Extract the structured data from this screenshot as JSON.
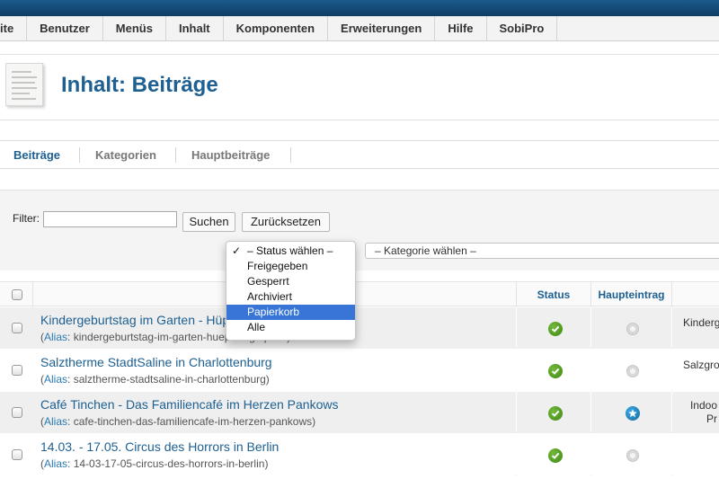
{
  "menu": {
    "items": [
      "ite",
      "Benutzer",
      "Menüs",
      "Inhalt",
      "Komponenten",
      "Erweiterungen",
      "Hilfe",
      "SobiPro"
    ]
  },
  "header": {
    "title": "Inhalt: Beiträge",
    "icon": "articles-icon"
  },
  "subnav": {
    "tabs": [
      "Beiträge",
      "Kategorien",
      "Hauptbeiträge"
    ],
    "active": "Beiträge"
  },
  "filter": {
    "label": "Filter:",
    "value": "",
    "search_button": "Suchen",
    "reset_button": "Zurücksetzen",
    "category_select": "– Kategorie wählen –"
  },
  "status_dropdown": {
    "options": [
      "– Status wählen –",
      "Freigegeben",
      "Gesperrt",
      "Archiviert",
      "Papierkorb",
      "Alle"
    ],
    "checked": "– Status wählen –",
    "highlighted": "Papierkorb"
  },
  "table": {
    "headers": {
      "status": "Status",
      "featured": "Haupteintrag"
    },
    "alias_label": "Alias",
    "rows": [
      {
        "title": "Kindergeburtstag im Garten - Hüpf",
        "alias": "kindergeburtstag-im-garten-huepfburg-spass",
        "status": "published",
        "featured": false,
        "category": "Kinderg"
      },
      {
        "title": "Salztherme StadtSaline in Charlottenburg",
        "alias": "salztherme-stadtsaline-in-charlottenburg",
        "status": "published",
        "featured": false,
        "category": "Salzgro"
      },
      {
        "title": "Café Tinchen - Das Familiencafé im Herzen Pankows",
        "alias": "cafe-tinchen-das-familiencafe-im-herzen-pankows",
        "status": "published",
        "featured": true,
        "category": "Indoo\nPr"
      },
      {
        "title": "14.03. - 17.05. Circus des Horrors in Berlin",
        "alias": "14-03-17-05-circus-des-horrors-in-berlin",
        "status": "published",
        "featured": false,
        "category": ""
      }
    ]
  },
  "colors": {
    "link": "#1e6092",
    "topbar": "#0d3d63",
    "published": "#3d8a16",
    "featured": "#12709f",
    "highlight": "#3875d7"
  }
}
